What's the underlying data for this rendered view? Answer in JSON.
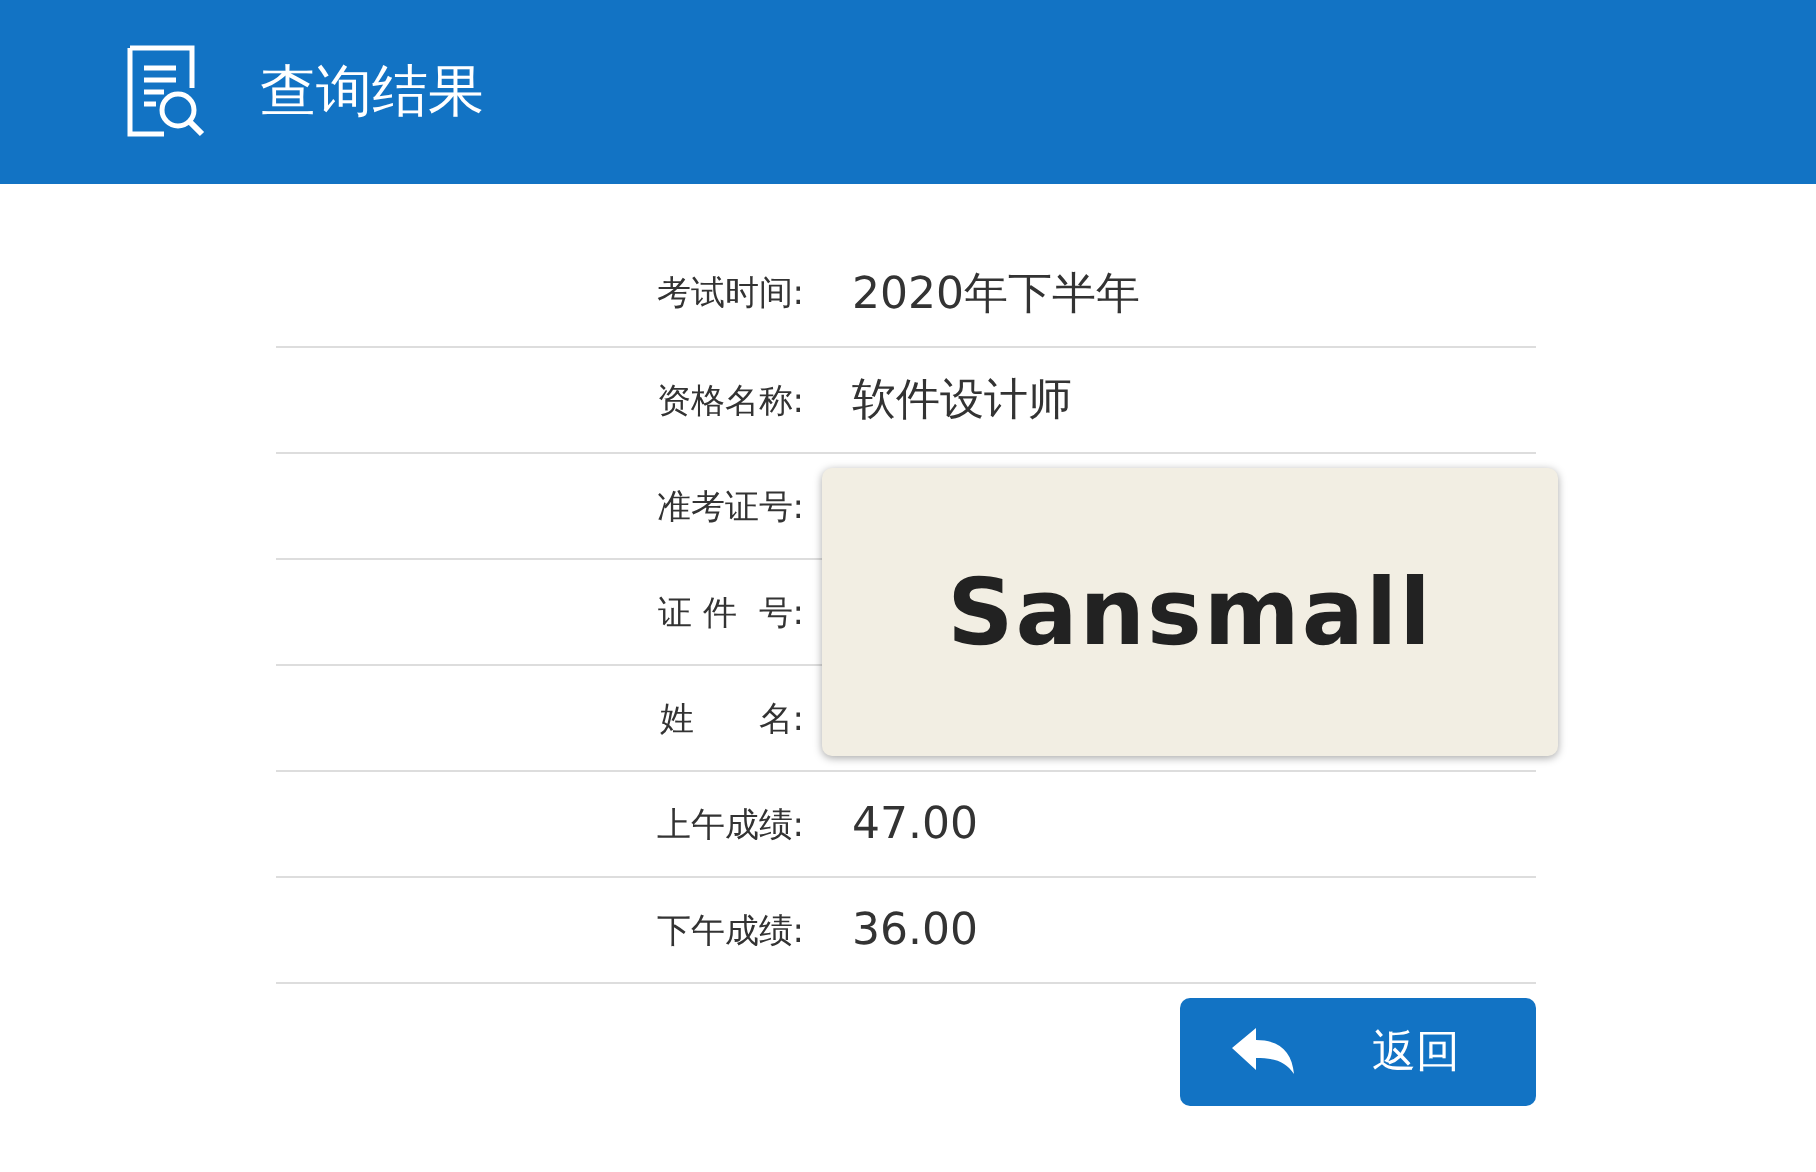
{
  "header": {
    "title": "查询结果"
  },
  "rows": [
    {
      "label": "考试时间:",
      "value": "2020年下半年"
    },
    {
      "label": "资格名称:",
      "value": "软件设计师"
    },
    {
      "label": "准考证号:"
    },
    {
      "label": "证 件  号:"
    },
    {
      "label": "姓      名:"
    },
    {
      "label": "上午成绩:",
      "value": "47.00"
    },
    {
      "label": "下午成绩:",
      "value": "36.00"
    }
  ],
  "overlay": {
    "text": "Sansmall"
  },
  "back_button": {
    "label": "返回"
  }
}
